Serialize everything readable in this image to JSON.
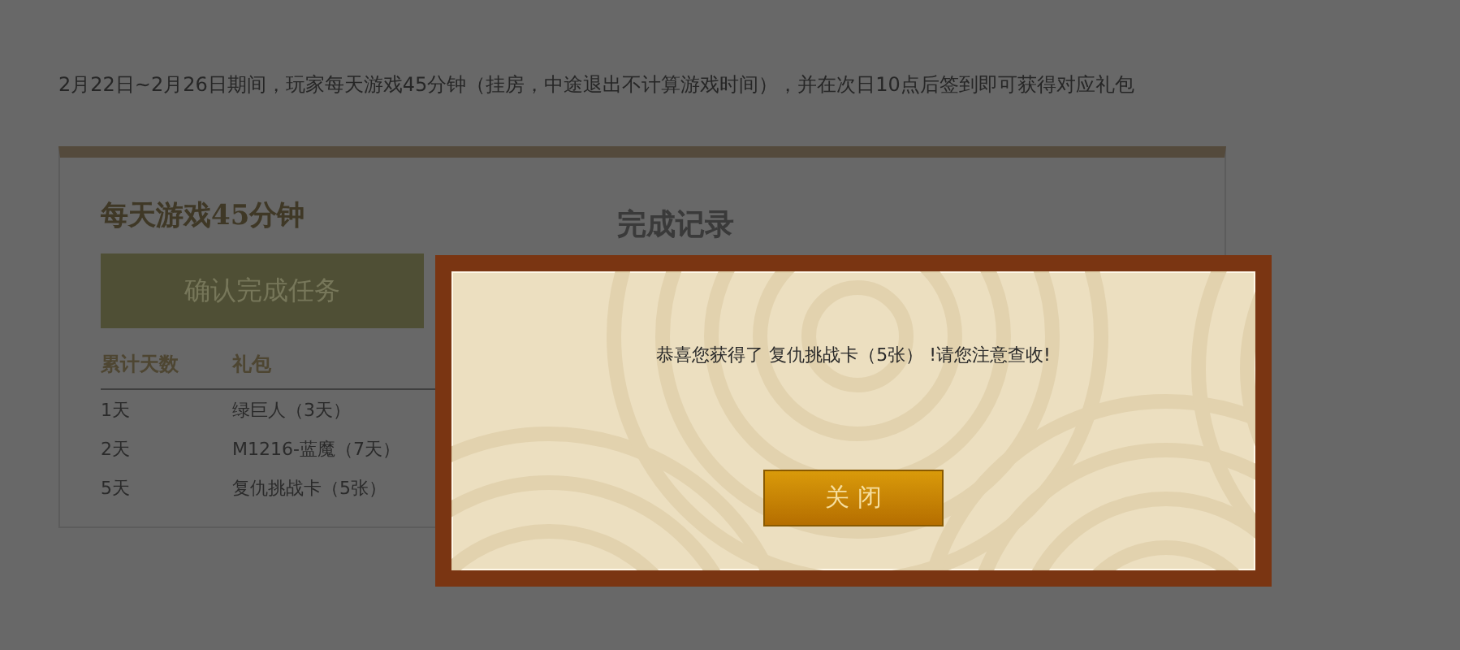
{
  "intro": "2月22日~2月26日期间，玩家每天游戏45分钟（挂房，中途退出不计算游戏时间），并在次日10点后签到即可获得对应礼包",
  "task": {
    "title": "每天游戏45分钟",
    "button": "确认完成任务",
    "columns": [
      "累计天数",
      "礼包"
    ],
    "rows": [
      [
        "1天",
        "绿巨人（3天）"
      ],
      [
        "2天",
        "M1216-蓝魔（7天）"
      ],
      [
        "5天",
        "复仇挑战卡（5张）"
      ]
    ]
  },
  "record": {
    "title": "完成记录"
  },
  "dialog": {
    "message": "恭喜您获得了 复仇挑战卡（5张） !请您注意查收!",
    "button": "关 闭"
  }
}
